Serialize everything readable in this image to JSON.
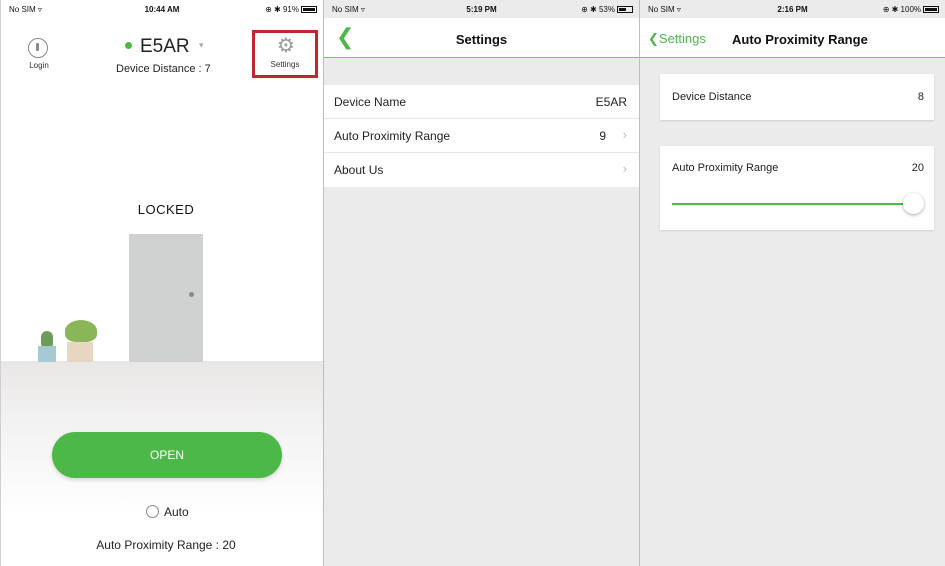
{
  "screen1": {
    "status": {
      "carrier": "No SIM ▿",
      "time": "10:44 AM",
      "right": "⊕ ✱ 91%",
      "battery_level": 0.91
    },
    "login_label": "Login",
    "device_name": "E5AR",
    "device_distance": "Device Distance : 7",
    "settings_label": "Settings",
    "lock_state": "LOCKED",
    "open_button": "OPEN",
    "auto_label": "Auto",
    "auto_checked": false,
    "range_text": "Auto Proximity Range : 20",
    "colors": {
      "accent": "#4cb848",
      "highlight_box": "#c0262d"
    }
  },
  "screen2": {
    "status": {
      "carrier": "No SIM ▿",
      "time": "5:19 PM",
      "right": "⊕ ✱ 53%",
      "battery_level": 0.53
    },
    "title": "Settings",
    "rows": [
      {
        "label": "Device Name",
        "value": "E5AR",
        "chevron": false
      },
      {
        "label": "Auto Proximity Range",
        "value": "9",
        "chevron": true
      },
      {
        "label": "About Us",
        "value": "",
        "chevron": true
      }
    ]
  },
  "screen3": {
    "status": {
      "carrier": "No SIM ▿",
      "time": "2:16 PM",
      "right": "⊕ ✱ 100%",
      "battery_level": 1.0
    },
    "back_label": "Settings",
    "title": "Auto Proximity Range",
    "device_distance": {
      "label": "Device Distance",
      "value": "8"
    },
    "proximity": {
      "label": "Auto Proximity Range",
      "value": "20",
      "slider_level": 1.0
    }
  }
}
